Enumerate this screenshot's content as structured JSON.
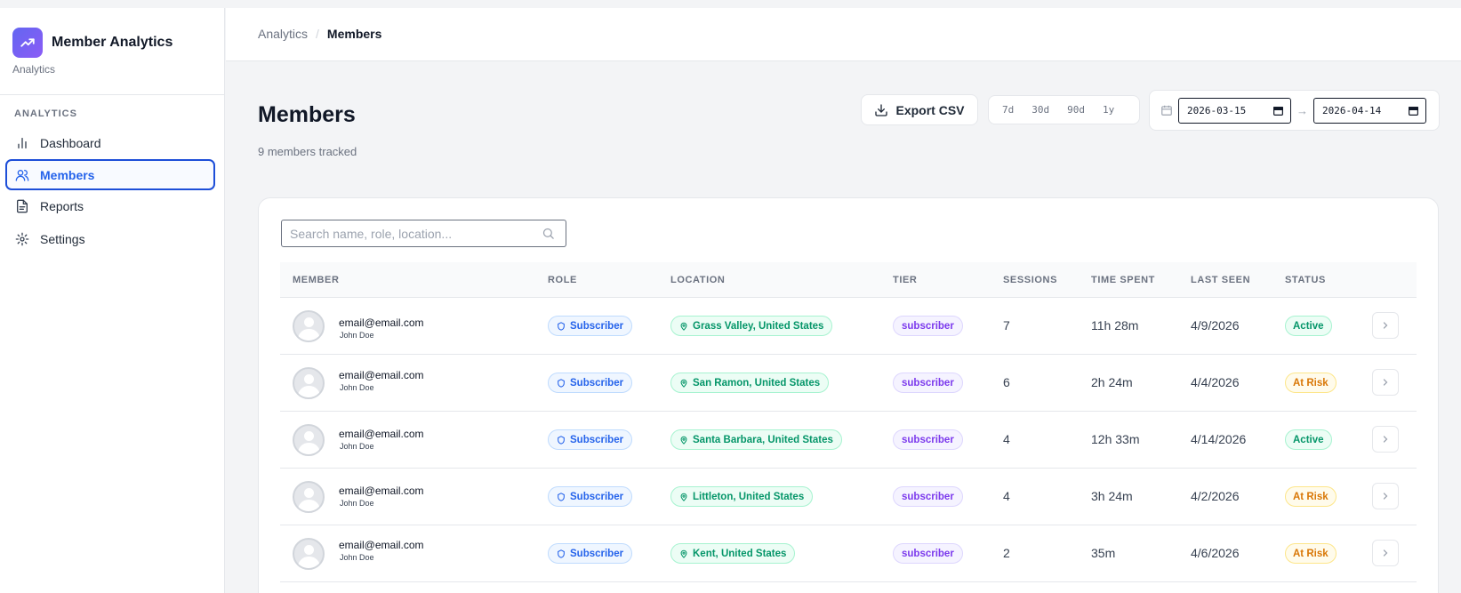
{
  "app": {
    "name": "Member Analytics",
    "subtitle": "Analytics"
  },
  "sidebar": {
    "section": "ANALYTICS",
    "items": [
      {
        "label": "Dashboard",
        "icon": "bar-chart-icon"
      },
      {
        "label": "Members",
        "icon": "users-icon",
        "active": true
      },
      {
        "label": "Reports",
        "icon": "document-icon"
      },
      {
        "label": "Settings",
        "icon": "gear-icon"
      }
    ]
  },
  "breadcrumb": {
    "parent": "Analytics",
    "separator": "/",
    "current": "Members"
  },
  "page": {
    "title": "Members",
    "subtitle": "9 members tracked"
  },
  "toolbar": {
    "export_label": "Export CSV",
    "ranges": [
      "7d",
      "30d",
      "90d",
      "1y"
    ],
    "date_from": "2026-03-15",
    "date_arrow": "→",
    "date_to": "2026-04-14"
  },
  "search": {
    "placeholder": "Search name, role, location..."
  },
  "table": {
    "columns": [
      "MEMBER",
      "ROLE",
      "LOCATION",
      "TIER",
      "SESSIONS",
      "TIME SPENT",
      "LAST SEEN",
      "STATUS"
    ],
    "rows": [
      {
        "email": "email@email.com",
        "name": "John Doe",
        "role": "Subscriber",
        "location": "Grass Valley, United States",
        "tier": "subscriber",
        "sessions": "7",
        "time_spent": "11h 28m",
        "last_seen": "4/9/2026",
        "status": "Active"
      },
      {
        "email": "email@email.com",
        "name": "John Doe",
        "role": "Subscriber",
        "location": "San Ramon, United States",
        "tier": "subscriber",
        "sessions": "6",
        "time_spent": "2h 24m",
        "last_seen": "4/4/2026",
        "status": "At Risk"
      },
      {
        "email": "email@email.com",
        "name": "John Doe",
        "role": "Subscriber",
        "location": "Santa Barbara, United States",
        "tier": "subscriber",
        "sessions": "4",
        "time_spent": "12h 33m",
        "last_seen": "4/14/2026",
        "status": "Active"
      },
      {
        "email": "email@email.com",
        "name": "John Doe",
        "role": "Subscriber",
        "location": "Littleton, United States",
        "tier": "subscriber",
        "sessions": "4",
        "time_spent": "3h 24m",
        "last_seen": "4/2/2026",
        "status": "At Risk"
      },
      {
        "email": "email@email.com",
        "name": "John Doe",
        "role": "Subscriber",
        "location": "Kent, United States",
        "tier": "subscriber",
        "sessions": "2",
        "time_spent": "35m",
        "last_seen": "4/6/2026",
        "status": "At Risk"
      }
    ]
  },
  "colors": {
    "accent": "#2563eb",
    "brand": "#6366f1",
    "active": "#059669",
    "at_risk": "#d97706",
    "tier": "#7c3aed"
  }
}
